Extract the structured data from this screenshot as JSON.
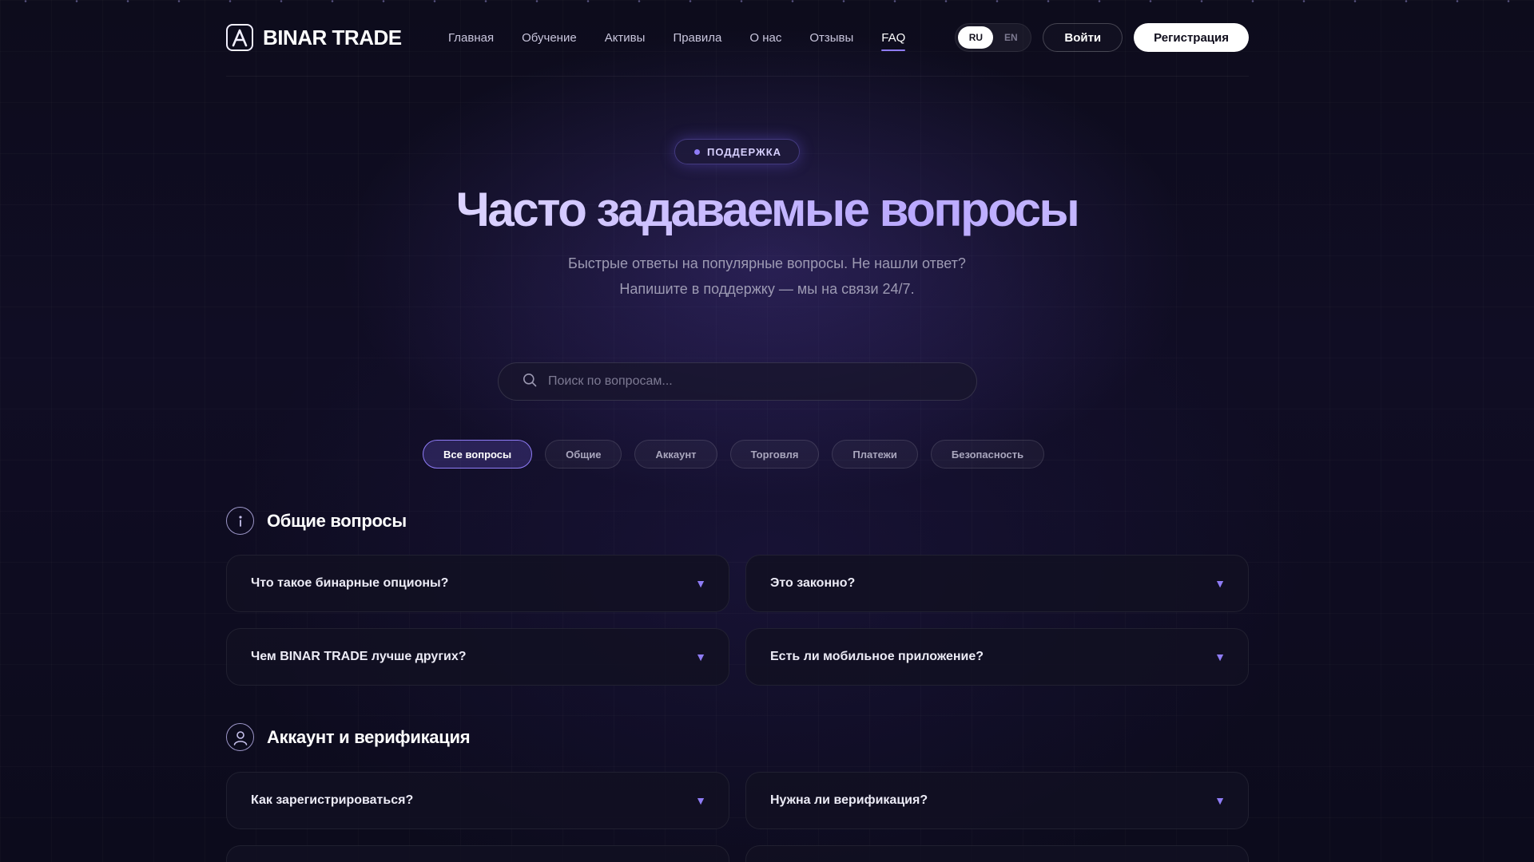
{
  "brand": {
    "name": "BINAR TRADE"
  },
  "nav": {
    "items": [
      {
        "label": "Главная"
      },
      {
        "label": "Обучение"
      },
      {
        "label": "Активы"
      },
      {
        "label": "Правила"
      },
      {
        "label": "О нас"
      },
      {
        "label": "Отзывы"
      },
      {
        "label": "FAQ",
        "active": true
      }
    ]
  },
  "header": {
    "lang": {
      "ru": "RU",
      "en": "EN",
      "selected": "RU"
    },
    "login_label": "Войти",
    "register_label": "Регистрация"
  },
  "hero": {
    "badge": "ПОДДЕРЖКА",
    "title": "Часто задаваемые вопросы",
    "subtitle_line1": "Быстрые ответы на популярные вопросы. Не нашли ответ?",
    "subtitle_line2": "Напишите в поддержку — мы на связи 24/7."
  },
  "search": {
    "placeholder": "Поиск по вопросам...",
    "value": ""
  },
  "filters": [
    {
      "label": "Все вопросы",
      "active": true
    },
    {
      "label": "Общие"
    },
    {
      "label": "Аккаунт"
    },
    {
      "label": "Торговля"
    },
    {
      "label": "Платежи"
    },
    {
      "label": "Безопасность"
    }
  ],
  "sections": [
    {
      "title": "Общие вопросы",
      "icon": "info-icon",
      "questions": [
        "Что такое бинарные опционы?",
        "Это законно?",
        "Чем BINAR TRADE лучше других?",
        "Есть ли мобильное приложение?"
      ]
    },
    {
      "title": "Аккаунт и верификация",
      "icon": "user-icon",
      "questions": [
        "Как зарегистрироваться?",
        "Нужна ли верификация?"
      ]
    }
  ],
  "colors": {
    "accent": "#8f7cf6",
    "background": "#0b0b16",
    "card": "#121022"
  }
}
